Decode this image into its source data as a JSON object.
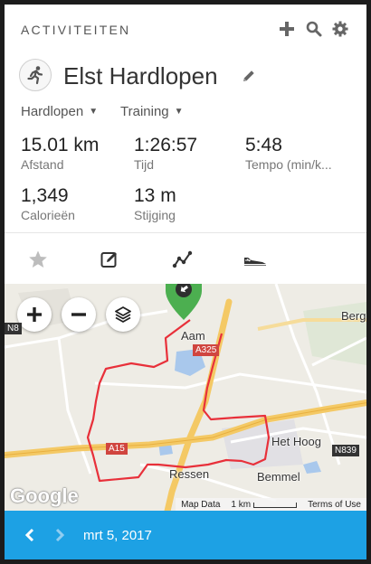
{
  "header": {
    "title": "ACTIVITEITEN",
    "tools": [
      {
        "icon": "plus-icon"
      },
      {
        "icon": "search-icon"
      },
      {
        "icon": "gear-icon"
      }
    ]
  },
  "activity": {
    "type_icon": "running-icon",
    "name": "Elst Hardlopen",
    "sport_select": "Hardlopen",
    "category_select": "Training",
    "stats": {
      "distance": {
        "value": "15.01 km",
        "label": "Afstand"
      },
      "time": {
        "value": "1:26:57",
        "label": "Tijd"
      },
      "pace": {
        "value": "5:48",
        "label": "Tempo (min/k..."
      },
      "calories": {
        "value": "1,349",
        "label": "Calorieën"
      },
      "elevation": {
        "value": "13 m",
        "label": "Stijging"
      }
    }
  },
  "actions": [
    {
      "icon": "star-icon"
    },
    {
      "icon": "edit-note-icon"
    },
    {
      "icon": "chart-line-icon"
    },
    {
      "icon": "shoe-icon"
    }
  ],
  "map": {
    "labels": {
      "aam": "Aam",
      "berg": "Berg",
      "het_hoog": "Het Hoog",
      "ressen": "Ressen",
      "bemmel": "Bemmel"
    },
    "road_signs": {
      "a325": "A325",
      "a15": "A15",
      "n839": "N839",
      "n8": "N8"
    },
    "google": "Google",
    "map_data": "Map Data",
    "scale": "1 km",
    "terms": "Terms of Use",
    "route_color": "#e8303a",
    "marker_color": "#4caf50"
  },
  "footer": {
    "date": "mrt 5, 2017",
    "accent_color": "#1da1e4"
  }
}
